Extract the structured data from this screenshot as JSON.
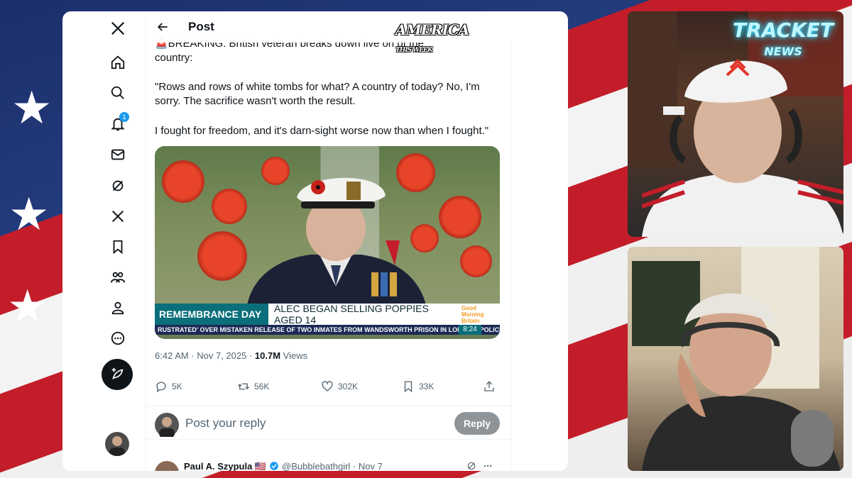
{
  "header": {
    "title": "Post"
  },
  "overlay_logo": {
    "line1": "AMERICA",
    "line2": "THIS WEEK"
  },
  "rail": {
    "notification_count": "1"
  },
  "tweet": {
    "line1": "🚨BREAKING: British veteran breaks down live on",
    "line1_end": "of the",
    "line2": "country:",
    "quote": "\"Rows and rows of white tombs for what? A country of today? No, I'm sorry. The sacrifice wasn't worth the result.",
    "closing": "I fought for freedom, and it's darn-sight worse now than when I fought.\"",
    "banner_left": "REMEMBRANCE DAY",
    "banner_right": "ALEC BEGAN SELLING POPPIES AGED 14",
    "gmb_line1": "Good",
    "gmb_line2": "Morning",
    "gmb_line3": "Britain",
    "ticker": "RUSTRATED' OVER MISTAKEN RELEASE OF TWO INMATES FROM WANDSWORTH PRISON IN LONDON. POLICE AR",
    "clock": "8:24",
    "time": "6:42 AM · Nov 7, 2025 · ",
    "views_count": "10.7M",
    "views_label": " Views"
  },
  "actions": {
    "replies": "5K",
    "reposts": "56K",
    "likes": "302K",
    "bookmarks": "33K"
  },
  "reply": {
    "placeholder": "Post your reply",
    "button": "Reply"
  },
  "next_reply": {
    "name": "Paul A. Szypula 🇺🇸",
    "handle": "@Bubblebathgirl · Nov 7"
  },
  "cam1": {
    "sign_line1": "TRACKET",
    "sign_line2": "NEWS"
  },
  "colors": {
    "x_blue": "#1d9bf0",
    "gmb_teal": "#0a6f7a",
    "flag_red": "#c31d2a",
    "flag_blue": "#1c2f6b"
  }
}
